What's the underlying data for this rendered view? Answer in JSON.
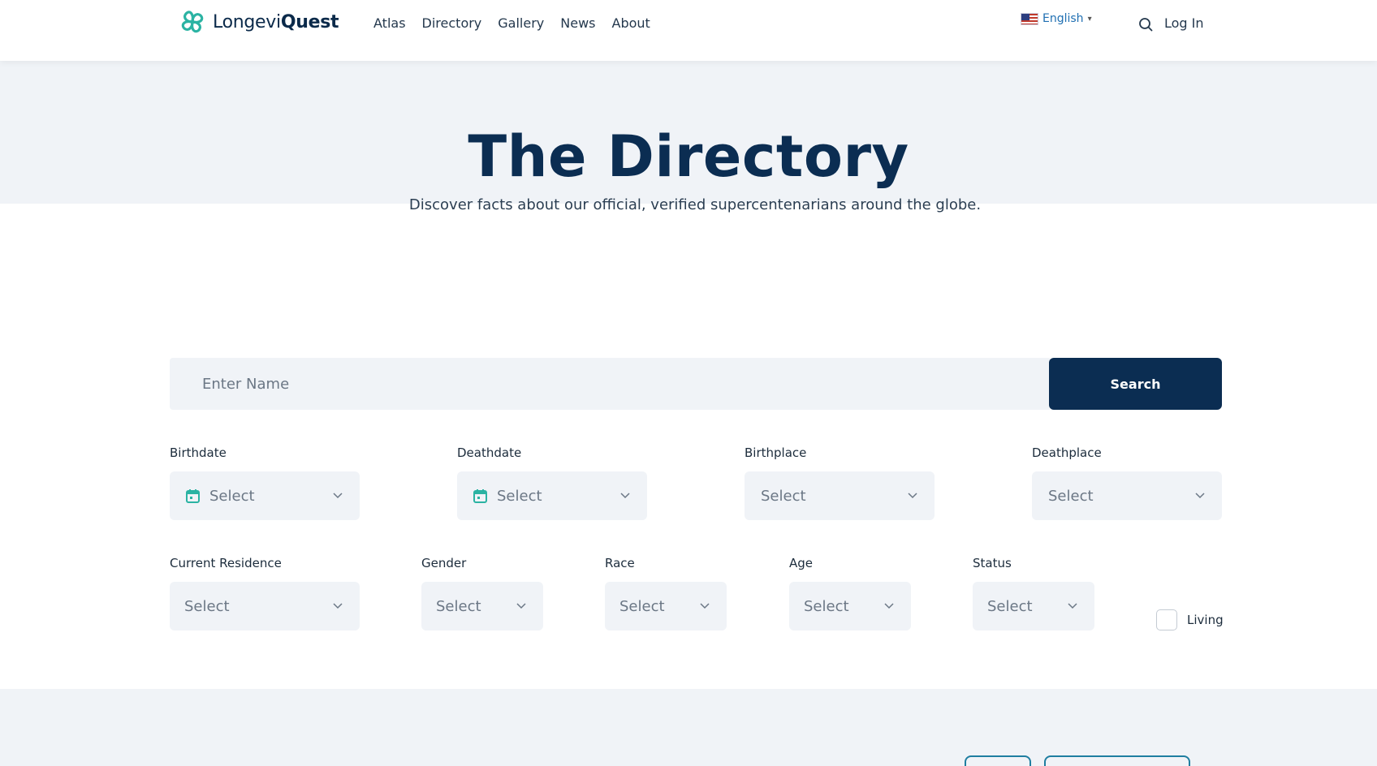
{
  "header": {
    "logo_prefix": "Longevi",
    "logo_suffix": "Quest",
    "nav": [
      "Atlas",
      "Directory",
      "Gallery",
      "News",
      "About"
    ],
    "language": "English",
    "language_caret": "▾",
    "login": "Log In"
  },
  "hero": {
    "title": "The Directory",
    "subtitle": "Discover facts about our official, verified supercentenarians around the globe."
  },
  "search": {
    "placeholder": "Enter Name",
    "button": "Search"
  },
  "filters": {
    "birthdate": {
      "label": "Birthdate",
      "value": "Select"
    },
    "deathdate": {
      "label": "Deathdate",
      "value": "Select"
    },
    "birthplace": {
      "label": "Birthplace",
      "value": "Select"
    },
    "deathplace": {
      "label": "Deathplace",
      "value": "Select"
    },
    "current_residence": {
      "label": "Current Residence",
      "value": "Select"
    },
    "gender": {
      "label": "Gender",
      "value": "Select"
    },
    "race": {
      "label": "Race",
      "value": "Select"
    },
    "age": {
      "label": "Age",
      "value": "Select"
    },
    "status": {
      "label": "Status",
      "value": "Select"
    },
    "living": {
      "label": "Living",
      "checked": false
    }
  },
  "colors": {
    "brand_navy": "#0b2d52",
    "accent_teal": "#2bb3a3",
    "field_bg": "#f0f3f7"
  },
  "icons": [
    "logo-mark-icon",
    "us-flag-icon",
    "search-icon",
    "calendar-icon",
    "chevron-down-icon"
  ]
}
